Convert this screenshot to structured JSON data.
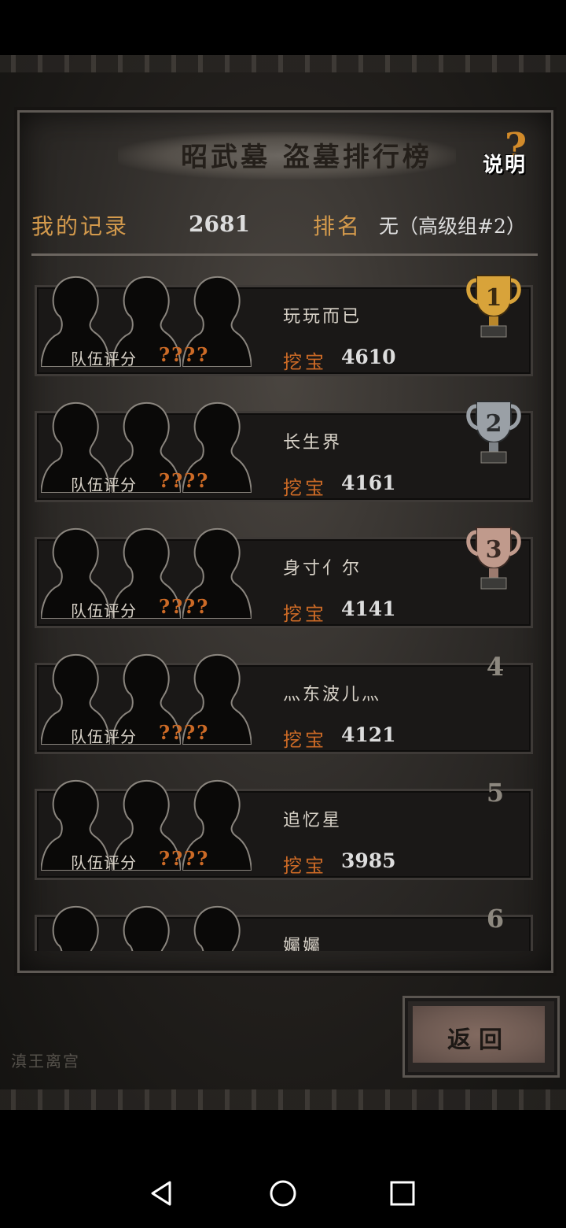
{
  "header": {
    "title": "昭武墓 盗墓排行榜",
    "help_question": "?",
    "help_label": "说明"
  },
  "my_record": {
    "label": "我的记录",
    "score": "2681",
    "rank_label": "排名",
    "rank_value": "无（高级组#2）"
  },
  "ranking": {
    "team_label": "队伍评分",
    "dig_label": "挖宝",
    "entries": [
      {
        "rank": "1",
        "name": "玩玩而已",
        "team_score": "????",
        "dig_score": "4610",
        "trophy": "gold"
      },
      {
        "rank": "2",
        "name": "长生界",
        "team_score": "????",
        "dig_score": "4161",
        "trophy": "silver"
      },
      {
        "rank": "3",
        "name": "身寸亻尔",
        "team_score": "????",
        "dig_score": "4141",
        "trophy": "bronze"
      },
      {
        "rank": "4",
        "name": "灬东波儿灬",
        "team_score": "????",
        "dig_score": "4121"
      },
      {
        "rank": "5",
        "name": "追忆星",
        "team_score": "????",
        "dig_score": "3985"
      },
      {
        "rank": "6",
        "name": "孎孎"
      }
    ]
  },
  "background": {
    "map_label": "滇王离宫"
  },
  "footer": {
    "back_label": "返回"
  },
  "colors": {
    "accent_orange": "#cc6a26",
    "label_gold": "#d49a4c",
    "trophy_gold": "#d8a33a",
    "trophy_silver": "#9aa0a6",
    "trophy_bronze": "#c09a8c"
  },
  "system_nav": {
    "back_icon": "triangle-back-icon",
    "home_icon": "circle-home-icon",
    "recents_icon": "square-recents-icon"
  }
}
